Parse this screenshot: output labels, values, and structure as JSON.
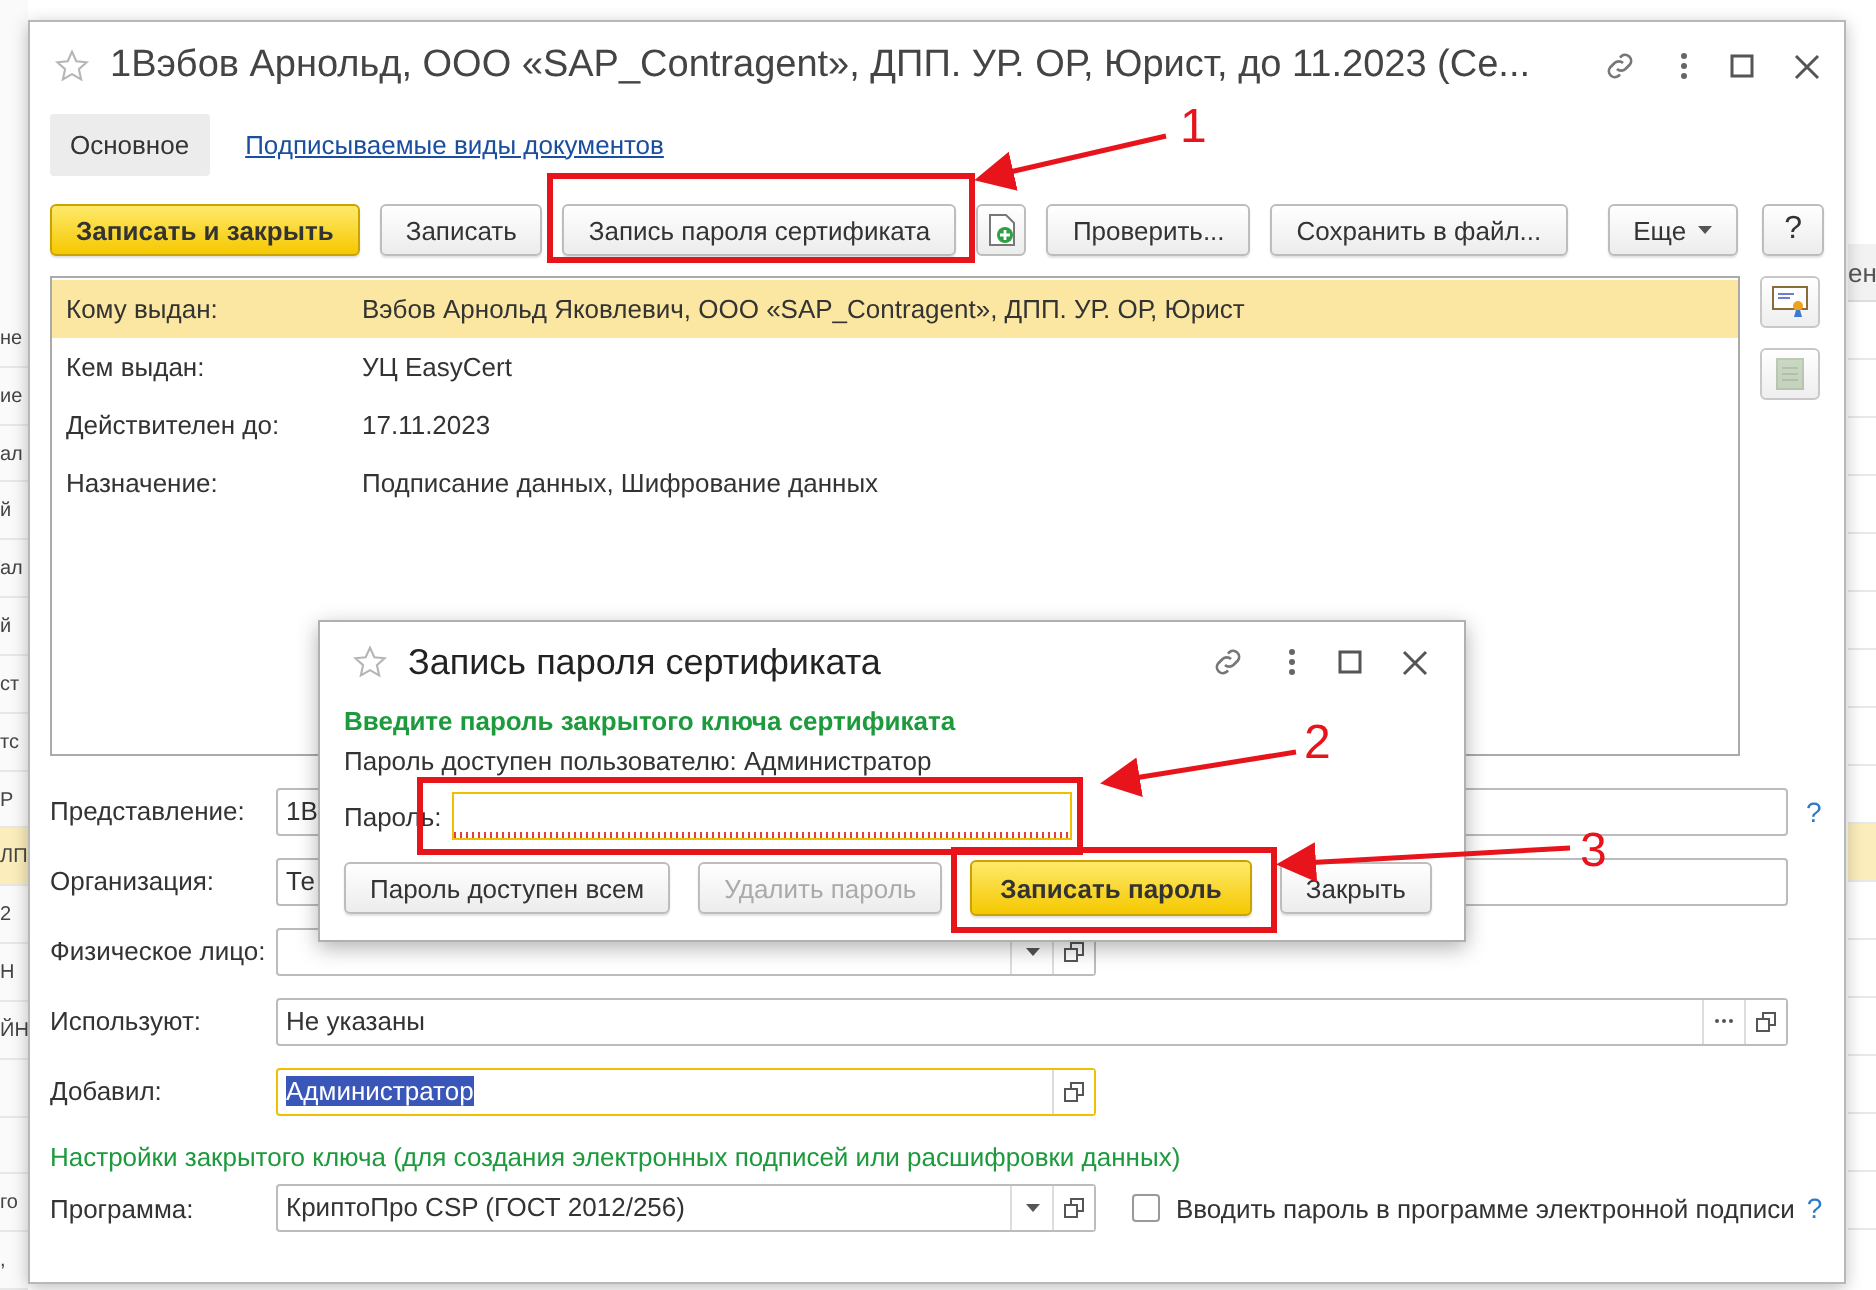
{
  "background": {
    "left_rows": [
      {
        "text": "не",
        "selected": false
      },
      {
        "text": "ие",
        "selected": false
      },
      {
        "text": "ал",
        "selected": false
      },
      {
        "text": "й",
        "selected": false
      },
      {
        "text": "ал",
        "selected": false
      },
      {
        "text": "й",
        "selected": false
      },
      {
        "text": "ст",
        "selected": false
      },
      {
        "text": "тс",
        "selected": false
      },
      {
        "text": "Р",
        "selected": false
      },
      {
        "text": "ЛП",
        "selected": true
      },
      {
        "text": "2",
        "selected": false
      },
      {
        "text": "Н",
        "selected": false
      },
      {
        "text": "ЙН",
        "selected": false
      },
      {
        "selected": false
      },
      {
        "selected": false
      },
      {
        "text": "го",
        "selected": false
      },
      {
        "text": ",",
        "selected": false
      }
    ],
    "right_header": "ен",
    "right_rows": [
      {
        "selected": false
      },
      {
        "selected": false
      },
      {
        "selected": false
      },
      {
        "selected": false
      },
      {
        "selected": false
      },
      {
        "selected": false
      },
      {
        "selected": false
      },
      {
        "selected": false
      },
      {
        "selected": false
      },
      {
        "selected": true
      },
      {
        "selected": false
      },
      {
        "selected": false
      },
      {
        "selected": false
      },
      {
        "selected": false
      },
      {
        "selected": false
      },
      {
        "selected": false
      }
    ]
  },
  "window": {
    "title": "1Вэбов Арнольд, ООО «SAP_Contragent», ДПП. УР. ОР, Юрист, до 11.2023 (Се...",
    "favorite": false
  },
  "tabs": [
    {
      "label": "Основное",
      "selected": true
    },
    {
      "label": "Подписываемые виды документов",
      "selected": false
    }
  ],
  "toolbar": [
    {
      "kind": "button",
      "label": "Записать и закрыть",
      "primary": true
    },
    {
      "kind": "button",
      "label": "Записать",
      "primary": false
    },
    {
      "kind": "button",
      "label": "Запись пароля сертификата",
      "primary": false
    },
    {
      "kind": "icon"
    },
    {
      "kind": "button",
      "label": "Проверить...",
      "primary": false
    },
    {
      "kind": "button",
      "label": "Сохранить в файл...",
      "primary": false
    },
    {
      "kind": "spacer"
    },
    {
      "kind": "menu",
      "label": "Еще"
    },
    {
      "kind": "help",
      "label": "?"
    }
  ],
  "certificate_info": [
    {
      "label": "Кому выдан:",
      "value": "Вэбов Арнольд Яковлевич, ООО «SAP_Contragent», ДПП. УР. ОР, Юрист",
      "selected": true
    },
    {
      "label": "Кем выдан:",
      "value": "УЦ EasyCert",
      "selected": false
    },
    {
      "label": "Действителен до:",
      "value": "17.11.2023",
      "selected": false
    },
    {
      "label": "Назначение:",
      "value": "Подписание данных, Шифрование данных",
      "selected": false
    }
  ],
  "side_buttons": [
    {
      "kind": "certificate",
      "disabled": false
    },
    {
      "kind": "document",
      "disabled": true
    }
  ],
  "form": {
    "fields": [
      {
        "kind": "text",
        "label": "Представление:",
        "value": "1В",
        "help": "?",
        "focused": false
      },
      {
        "kind": "text",
        "label": "Организация:",
        "value": "Те",
        "focused": false
      },
      {
        "kind": "select",
        "label": "Физическое лицо:",
        "focused": false
      },
      {
        "kind": "choice",
        "label": "Используют:",
        "value": "Не указаны",
        "focused": false
      },
      {
        "kind": "reference",
        "label": "Добавил:",
        "value": "Администратор",
        "focused": true
      }
    ],
    "section_title": "Настройки закрытого ключа (для создания электронных подписей или расшифровки данных)",
    "program": {
      "kind": "select",
      "label": "Программа:",
      "value": "КриптоПро CSP (ГОСТ 2012/256)",
      "checkbox": {
        "label": "Вводить пароль в программе электронной подписи",
        "checked": false
      },
      "help": "?"
    }
  },
  "dialog": {
    "title": "Запись пароля сертификата",
    "favorite": false,
    "heading": "Введите пароль закрытого ключа сертификата",
    "note": "Пароль доступен пользователю: Администратор",
    "password": {
      "label": "Пароль:",
      "focused": true
    },
    "buttons": [
      {
        "label": "Пароль доступен всем",
        "primary": false,
        "disabled": false
      },
      {
        "label": "Удалить пароль",
        "primary": false,
        "disabled": true
      },
      {
        "label": "Записать пароль",
        "primary": true,
        "disabled": false
      },
      {
        "label": "Закрыть",
        "primary": false,
        "disabled": false
      }
    ]
  },
  "annotations": [
    {
      "number": "1"
    },
    {
      "number": "2"
    },
    {
      "number": "3"
    }
  ]
}
